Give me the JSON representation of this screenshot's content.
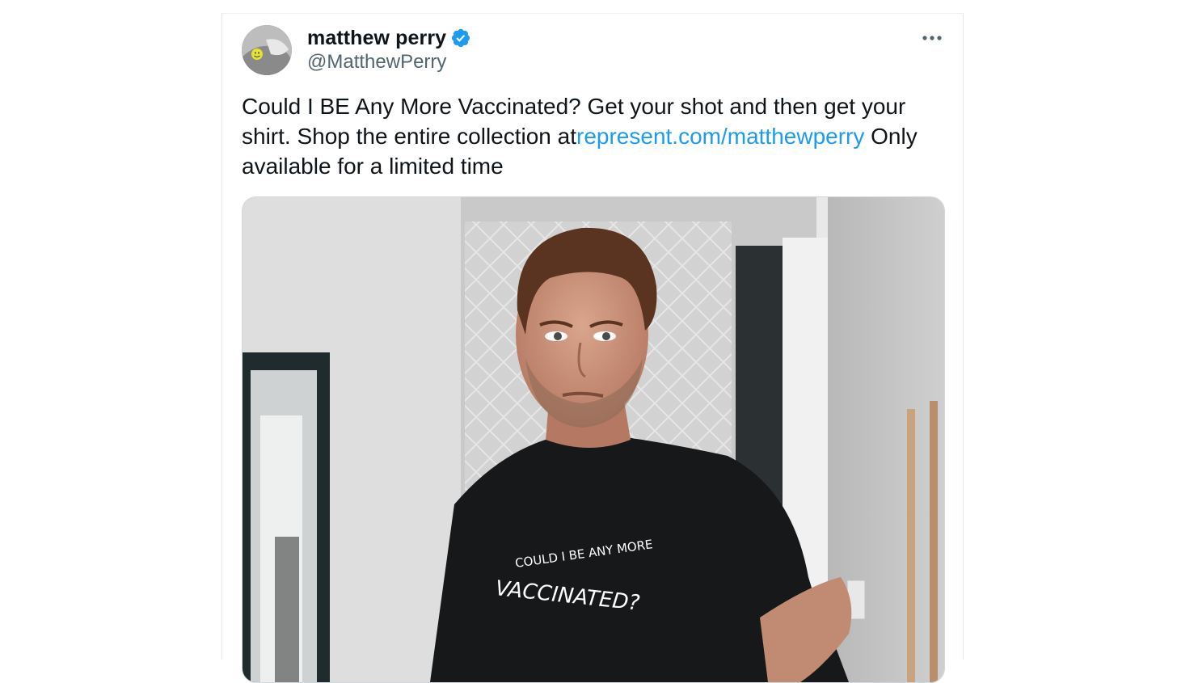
{
  "tweet": {
    "author": {
      "display_name": "matthew perry",
      "handle": "@MatthewPerry",
      "verified": true,
      "avatar_icon": "avatar-photo"
    },
    "more_icon": "more-horizontal-icon",
    "text_line_1": "Could I BE Any More Vaccinated? Get your shot and then get your shirt. Shop the entire collection at",
    "link_text": "represent.com/matthewperry",
    "text_after_link": " Only available for a limited time",
    "media": {
      "description_icon": "photo",
      "shirt_text_line_1": "COULD I BE ANY MORE",
      "shirt_text_line_2": "VACCINATED?"
    },
    "colors": {
      "link": "#1d9bf0",
      "verified_badge": "#1d9bf0",
      "text": "#0f1419",
      "secondary_text": "#536471"
    }
  }
}
